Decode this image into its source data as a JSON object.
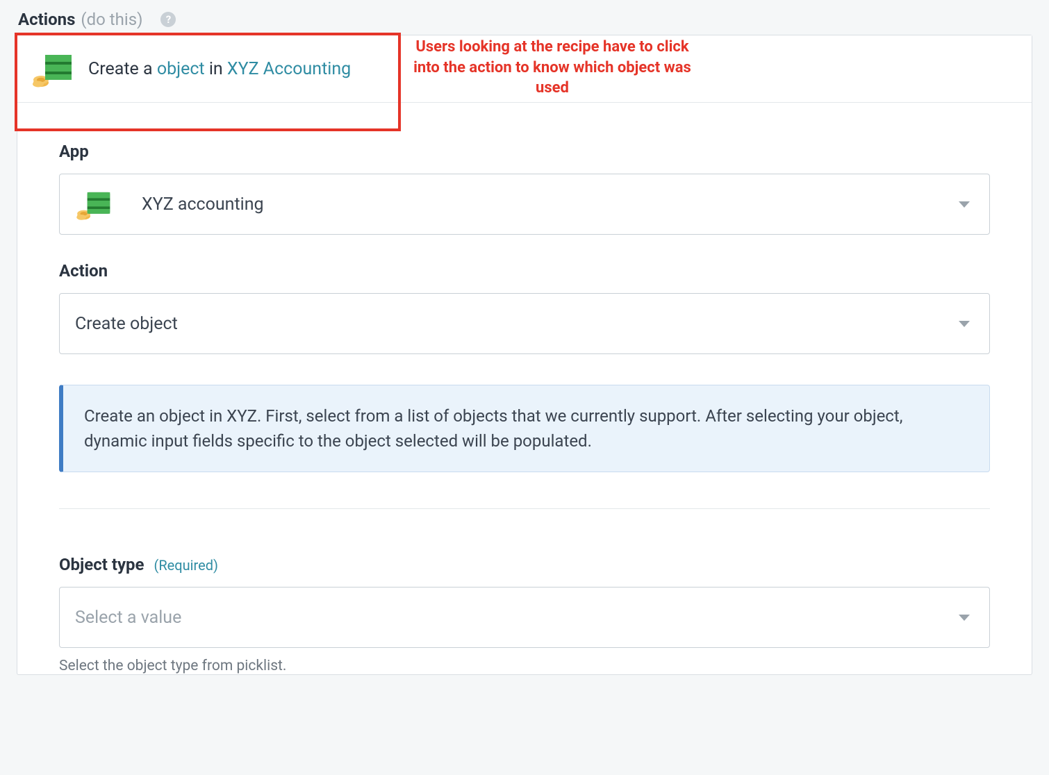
{
  "header": {
    "title": "Actions",
    "subtitle": "(do this)",
    "help_icon": "?"
  },
  "summary": {
    "prefix": "Create a ",
    "object_link": "object",
    "middle": " in ",
    "app_link": "XYZ Accounting"
  },
  "annotation": "Users looking at the recipe have to click into the action to know which object was used",
  "form": {
    "app": {
      "label": "App",
      "value": "XYZ accounting"
    },
    "action": {
      "label": "Action",
      "value": "Create object"
    },
    "info": "Create an object in XYZ. First, select from a list of objects that we currently support. After selecting your object, dynamic input fields specific to the object selected will be populated."
  },
  "object_type": {
    "label": "Object type",
    "required": "(Required)",
    "placeholder": "Select a value",
    "helper": "Select the object type from picklist."
  },
  "icons": {
    "money": "money-stack-icon"
  }
}
